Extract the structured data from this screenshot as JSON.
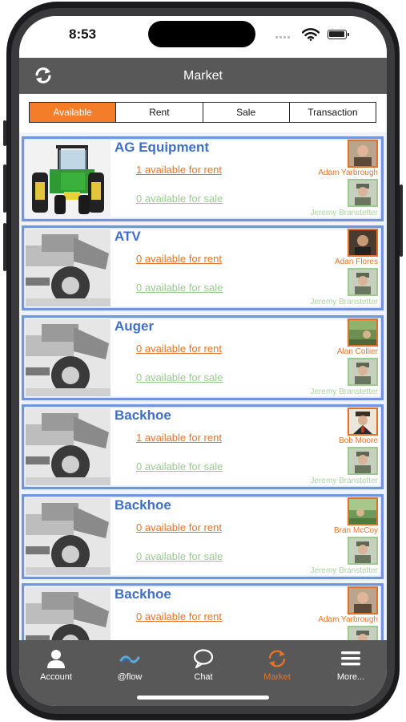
{
  "status": {
    "time": "8:53"
  },
  "header": {
    "title": "Market",
    "refresh_icon": "refresh-icon"
  },
  "tabs": [
    {
      "label": "Available",
      "active": true
    },
    {
      "label": "Rent",
      "active": false
    },
    {
      "label": "Sale",
      "active": false
    },
    {
      "label": "Transaction",
      "active": false
    }
  ],
  "listings": [
    {
      "name": "AG Equipment",
      "rent": "1 available for rent",
      "sale": "0 available for sale",
      "owner": "Adam Yarbrough",
      "seller": "Jeremy Branstetter",
      "thumb": "tractor"
    },
    {
      "name": "ATV",
      "rent": "0 available for rent",
      "sale": "0 available for sale",
      "owner": "Adan Flores",
      "seller": "Jeremy Branstetter",
      "thumb": "machine"
    },
    {
      "name": "Auger",
      "rent": "0 available for rent",
      "sale": "0 available for sale",
      "owner": "Alan Collier",
      "seller": "Jeremy Branstetter",
      "thumb": "machine"
    },
    {
      "name": "Backhoe",
      "rent": "1 available for rent",
      "sale": "0 available for sale",
      "owner": "Bob Moore",
      "seller": "Jeremy Branstetter",
      "thumb": "machine"
    },
    {
      "name": "Backhoe",
      "rent": "0 available for rent",
      "sale": "0 available for sale",
      "owner": "Bran McCoy",
      "seller": "Jeremy Branstetter",
      "thumb": "machine"
    },
    {
      "name": "Backhoe",
      "rent": "0 available for rent",
      "sale": "",
      "owner": "Adam Yarbrough",
      "seller": "",
      "thumb": "machine"
    }
  ],
  "bottom_tabs": [
    {
      "label": "Account",
      "icon": "person-icon",
      "active": false
    },
    {
      "label": "@flow",
      "icon": "flow-icon",
      "active": false
    },
    {
      "label": "Chat",
      "icon": "chat-bubble-icon",
      "active": false
    },
    {
      "label": "Market",
      "icon": "market-icon",
      "active": true
    },
    {
      "label": "More...",
      "icon": "menu-icon",
      "active": false
    }
  ],
  "colors": {
    "accent": "#f47d2a",
    "header": "#585858",
    "link_blue": "#3f6fc7",
    "sale_green": "#9ac98f"
  }
}
